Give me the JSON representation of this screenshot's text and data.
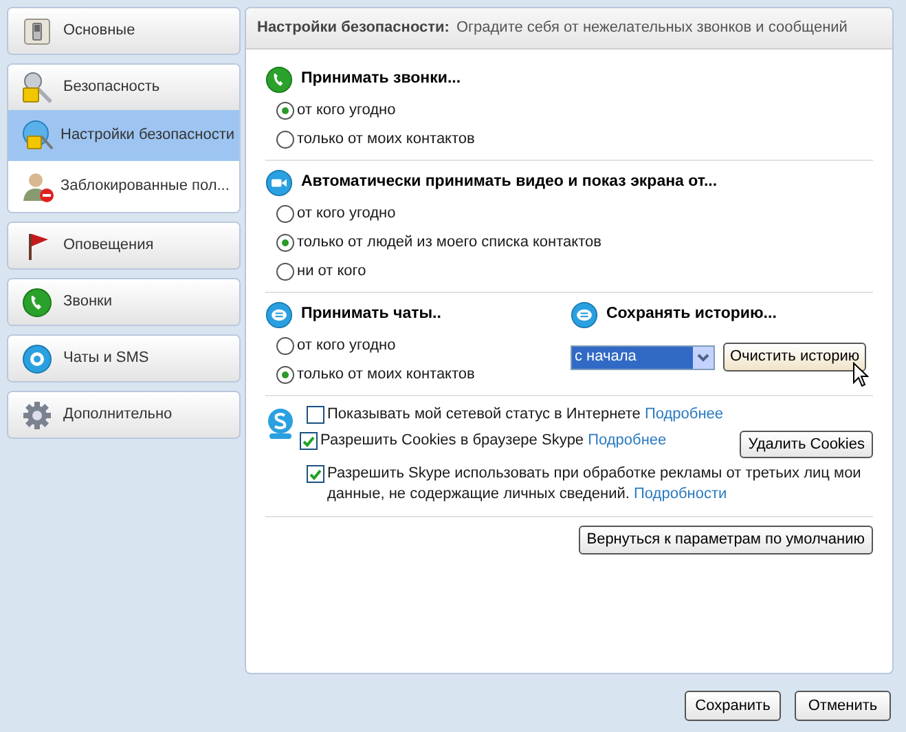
{
  "sidebar": {
    "groups": [
      {
        "label": "Основные"
      },
      {
        "label": "Безопасность",
        "children": [
          {
            "label": "Настройки безопасности",
            "selected": true
          },
          {
            "label": "Заблокированные пол...",
            "selected": false
          }
        ]
      },
      {
        "label": "Оповещения"
      },
      {
        "label": "Звонки"
      },
      {
        "label": "Чаты и SMS"
      },
      {
        "label": "Дополнительно"
      }
    ]
  },
  "header": {
    "title": "Настройки безопасности:",
    "subtitle": "Оградите себя от нежелательных звонков и сообщений"
  },
  "calls": {
    "title": "Принимать звонки...",
    "options": [
      {
        "label": "от кого угодно",
        "selected": true
      },
      {
        "label": "только от моих контактов",
        "selected": false
      }
    ]
  },
  "video": {
    "title": "Автоматически принимать видео и показ экрана от...",
    "options": [
      {
        "label": "от кого угодно",
        "selected": false
      },
      {
        "label": "только от людей из моего списка контактов",
        "selected": true
      },
      {
        "label": "ни от кого",
        "selected": false
      }
    ]
  },
  "chats": {
    "title": "Принимать чаты..",
    "options": [
      {
        "label": "от кого угодно",
        "selected": false
      },
      {
        "label": "только от моих контактов",
        "selected": true
      }
    ]
  },
  "history": {
    "title": "Сохранять историю...",
    "value": "с начала",
    "button": "Очистить историю"
  },
  "privacy": [
    {
      "text": "Показывать мой сетевой статус в Интернете",
      "link": "Подробнее",
      "checked": false
    },
    {
      "text": "Разрешить Cookies в браузере Skype",
      "link": "Подробнее",
      "checked": true,
      "button": "Удалить Cookies"
    },
    {
      "text": "Разрешить Skype использовать при обработке рекламы от третьих лиц мои данные, не содержащие личных сведений.",
      "link": "Подробности",
      "checked": true
    }
  ],
  "reset_button": "Вернуться к параметрам по умолчанию",
  "footer": {
    "buttons": [
      "Сохранить",
      "Отменить"
    ]
  }
}
